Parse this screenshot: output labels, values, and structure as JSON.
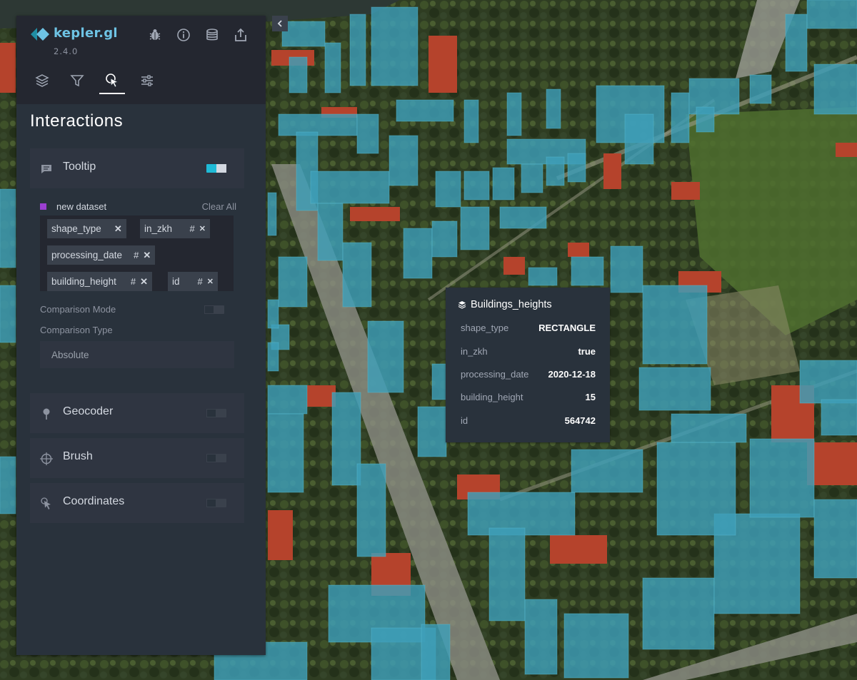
{
  "app": {
    "name": "kepler.gl",
    "version": "2.4.0"
  },
  "header": {
    "icons": [
      "bug-icon",
      "info-icon",
      "database-icon",
      "export-icon"
    ]
  },
  "tabs": [
    {
      "name": "layers",
      "icon": "layers-icon",
      "active": false
    },
    {
      "name": "filters",
      "icon": "filter-icon",
      "active": false
    },
    {
      "name": "interactions",
      "icon": "cursor-click-icon",
      "active": true
    },
    {
      "name": "base-map",
      "icon": "settings-sliders-icon",
      "active": false
    }
  ],
  "panel": {
    "title": "Interactions"
  },
  "tooltip": {
    "label": "Tooltip",
    "enabled": true,
    "dataset": {
      "name": "new dataset",
      "color": "#9b3fd1"
    },
    "clear_all": "Clear All",
    "fields": [
      {
        "name": "shape_type",
        "type": ""
      },
      {
        "name": "in_zkh",
        "type": "#"
      },
      {
        "name": "processing_date",
        "type": "#"
      },
      {
        "name": "building_height",
        "type": "#"
      },
      {
        "name": "id",
        "type": "#"
      }
    ],
    "comparison_mode_label": "Comparison Mode",
    "comparison_mode_enabled": false,
    "comparison_type_label": "Comparison Type",
    "comparison_type_value": "Absolute"
  },
  "geocoder": {
    "label": "Geocoder",
    "enabled": false
  },
  "brush": {
    "label": "Brush",
    "enabled": false
  },
  "coordinates": {
    "label": "Coordinates",
    "enabled": false
  },
  "map_tooltip": {
    "layer": "Buildings_heights",
    "rows": [
      {
        "key": "shape_type",
        "value": "RECTANGLE"
      },
      {
        "key": "in_zkh",
        "value": "true"
      },
      {
        "key": "processing_date",
        "value": "2020-12-18"
      },
      {
        "key": "building_height",
        "value": "15"
      },
      {
        "key": "id",
        "value": "564742"
      }
    ]
  },
  "colors": {
    "accent": "#1fbad6",
    "building": "#3e9fb8",
    "roof": "#b5432c",
    "panel": "#29323c"
  }
}
